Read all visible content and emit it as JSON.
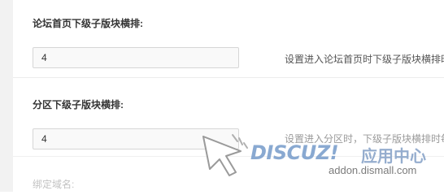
{
  "settings": [
    {
      "label": "论坛首页下级子版块横排:",
      "value": "4",
      "hint": "设置进入论坛首页时下级子版块横排时"
    },
    {
      "label": "分区下级子版块横排:",
      "value": "4",
      "hint": "设置进入分区时，下级子版块横排时每"
    },
    {
      "label": "绑定域名:"
    }
  ],
  "watermark": {
    "brand": "DISCUZ!",
    "brand_cn": "应用中心",
    "url": "addon.dismall.com",
    "colors": {
      "brand": "#7da0cd",
      "cn": "#8aa5c9",
      "url": "#7b7b7b"
    }
  }
}
